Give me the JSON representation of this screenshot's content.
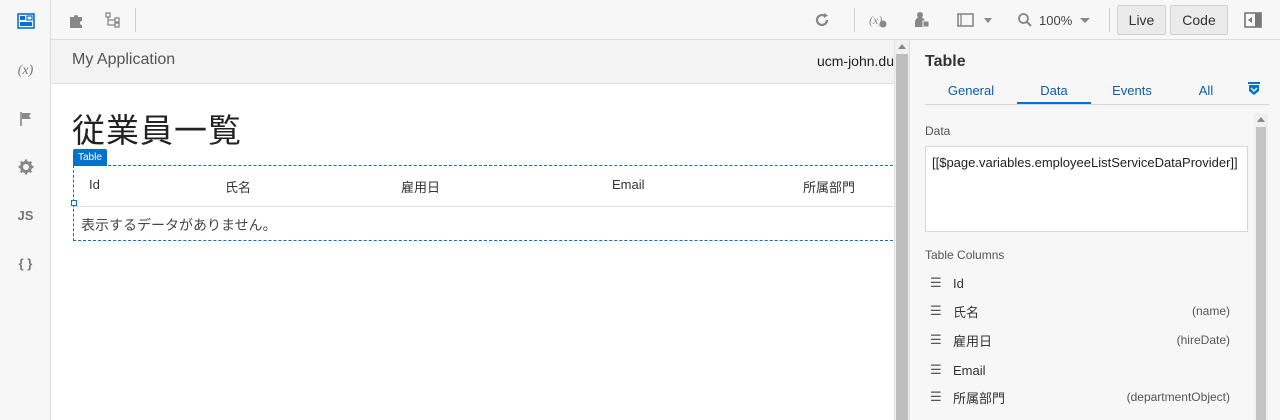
{
  "rail": {
    "items": [
      {
        "icon": "designer-icon"
      },
      {
        "icon": "variables-icon",
        "text": "(x)"
      },
      {
        "icon": "flag-icon"
      },
      {
        "icon": "settings-icon"
      },
      {
        "icon": "javascript-icon",
        "text": "JS"
      },
      {
        "icon": "json-icon",
        "text": "{ }"
      }
    ]
  },
  "toolbar": {
    "zoom": "100%",
    "live_label": "Live",
    "code_label": "Code"
  },
  "canvas": {
    "app_title": "My Application",
    "user": "ucm-john.du",
    "page_heading": "従業員一覧",
    "component_tag": "Table",
    "columns": [
      "Id",
      "氏名",
      "雇用日",
      "Email",
      "所属部門"
    ],
    "empty_message": "表示するデータがありません。"
  },
  "properties": {
    "title": "Table",
    "tabs": [
      "General",
      "Data",
      "Events",
      "All"
    ],
    "active_tab": "Data",
    "data_label": "Data",
    "data_value": "[[$page.variables.employeeListServiceDataProvider]]",
    "columns_label": "Table Columns",
    "columns": [
      {
        "label": "Id",
        "field": ""
      },
      {
        "label": "氏名",
        "field": "(name)"
      },
      {
        "label": "雇用日",
        "field": "(hireDate)"
      },
      {
        "label": "Email",
        "field": ""
      },
      {
        "label": "所属部門",
        "field": "(departmentObject)"
      }
    ]
  },
  "colors": {
    "accent": "#0572ce",
    "tab_text": "#0b5cad"
  }
}
